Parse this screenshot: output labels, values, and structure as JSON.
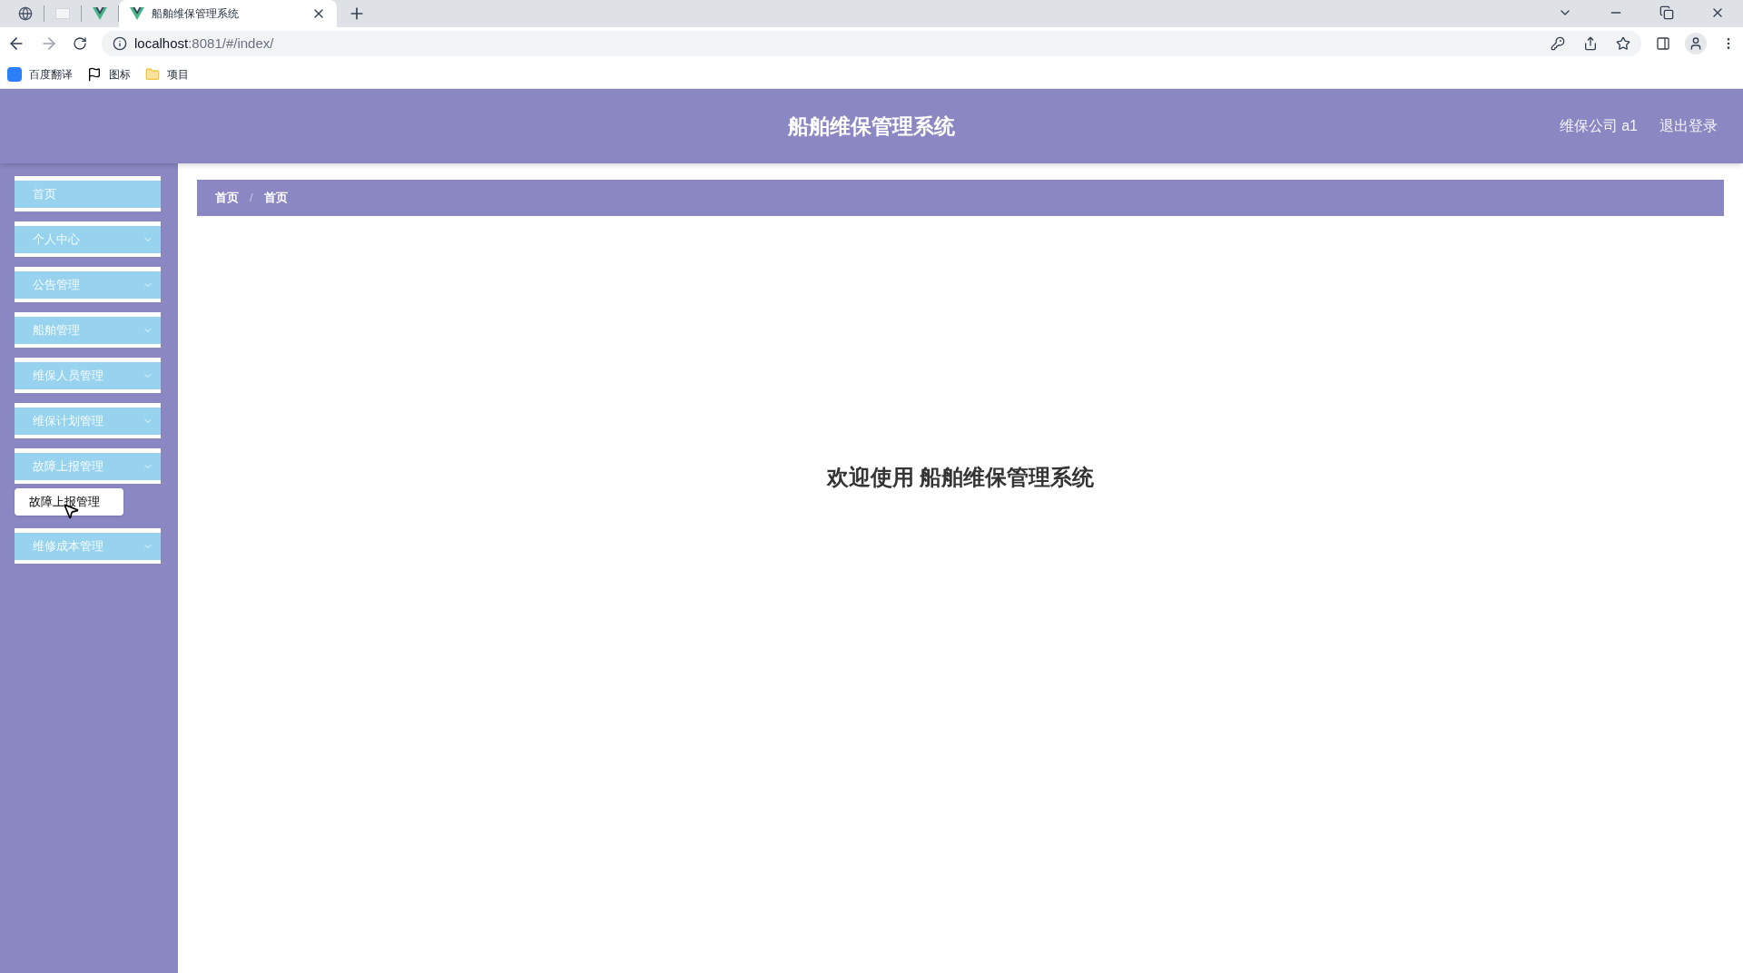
{
  "browser": {
    "tabs": [
      {
        "kind": "globe",
        "selected": false
      },
      {
        "kind": "blank",
        "selected": false
      },
      {
        "kind": "vue",
        "selected": false
      },
      {
        "kind": "vue",
        "title": "船舶维保管理系统",
        "selected": true
      }
    ],
    "address": {
      "host": "localhost",
      "rest": ":8081/#/index/"
    },
    "bookmarks": [
      {
        "kind": "translate",
        "label": "百度翻译"
      },
      {
        "kind": "flag",
        "label": "图标"
      },
      {
        "kind": "folder",
        "label": "项目"
      }
    ]
  },
  "header": {
    "title": "船舶维保管理系统",
    "user": "维保公司 a1",
    "logout": "退出登录"
  },
  "sidebar": {
    "items": [
      {
        "label": "首页",
        "kind": "link"
      },
      {
        "label": "个人中心",
        "kind": "submenu"
      },
      {
        "label": "公告管理",
        "kind": "submenu"
      },
      {
        "label": "船舶管理",
        "kind": "submenu"
      },
      {
        "label": "维保人员管理",
        "kind": "submenu"
      },
      {
        "label": "维保计划管理",
        "kind": "submenu"
      },
      {
        "label": "故障上报管理",
        "kind": "submenu",
        "tooltip": "故障上报管理"
      },
      {
        "label": "维修成本管理",
        "kind": "submenu"
      }
    ]
  },
  "breadcrumb": {
    "items": [
      "首页",
      "首页"
    ],
    "separator": "/"
  },
  "welcome": "欢迎使用 船舶维保管理系统"
}
